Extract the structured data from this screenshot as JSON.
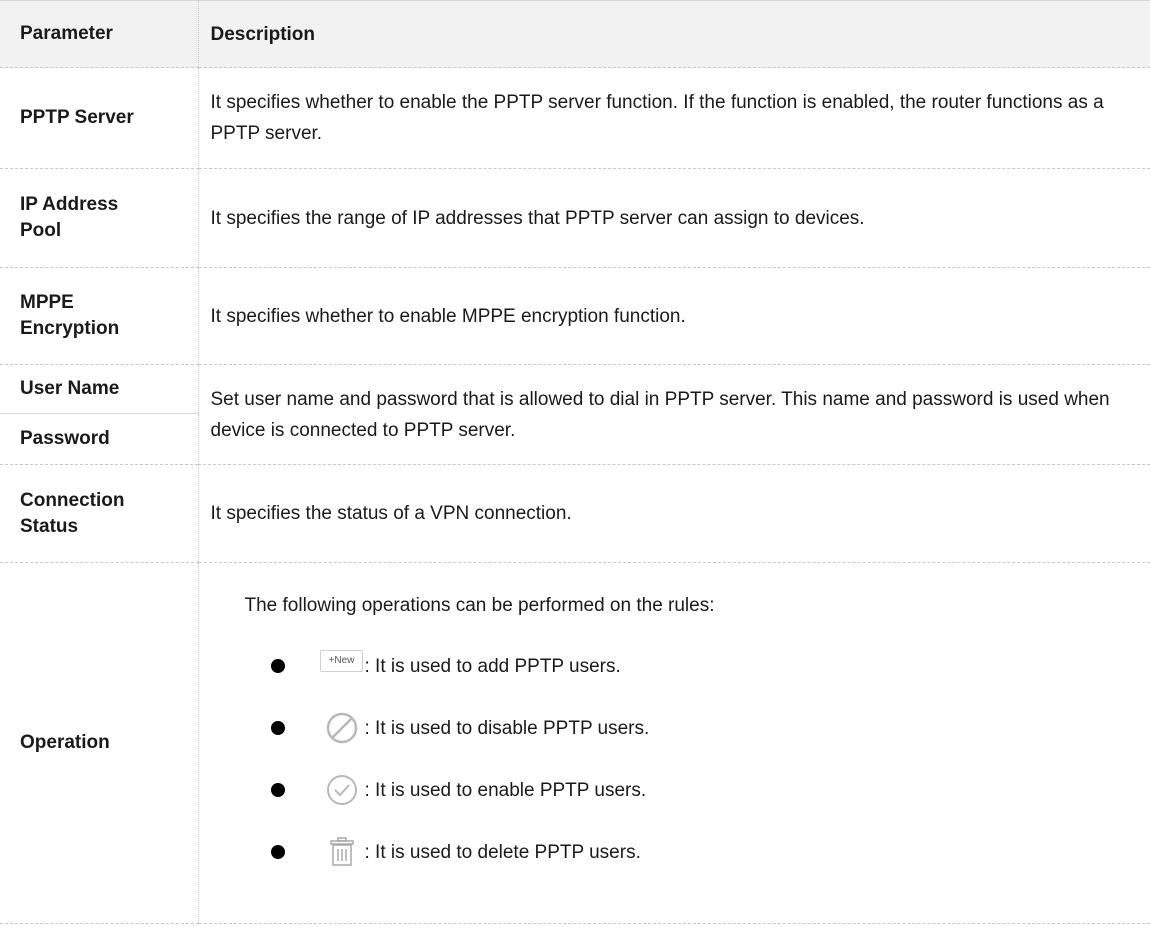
{
  "header": {
    "parameter": "Parameter",
    "description": "Description"
  },
  "rows": {
    "pptp_server": {
      "param": "PPTP Server",
      "desc": "It specifies whether to enable the PPTP server function. If the function is enabled, the router functions as a PPTP server."
    },
    "ip_pool": {
      "param_line1": "IP Address",
      "param_line2": "Pool",
      "desc": "It specifies the range of IP addresses that PPTP server can assign to devices."
    },
    "mppe": {
      "param_line1": "MPPE",
      "param_line2": "Encryption",
      "desc": "It specifies whether to enable MPPE encryption function."
    },
    "credentials": {
      "param_user": "User Name",
      "param_password": "Password",
      "desc": "Set user name and password that is allowed to dial in PPTP server. This name and password is used when device is connected to PPTP server."
    },
    "connection": {
      "param_line1": "Connection",
      "param_line2": "Status",
      "desc": "It specifies the status of a VPN connection."
    },
    "operation": {
      "param": "Operation",
      "intro": "The following operations can be performed on the rules:",
      "items": [
        {
          "icon": "new-button-icon",
          "button_label": "+New",
          "text": ": It is used to add PPTP users."
        },
        {
          "icon": "disable-icon",
          "text": ": It is used to disable PPTP users."
        },
        {
          "icon": "enable-check-icon",
          "text": ": It is used to enable PPTP users."
        },
        {
          "icon": "trash-icon",
          "text": ": It is used to delete PPTP users."
        }
      ]
    }
  },
  "colors": {
    "header_bg": "#f2f2f2",
    "border": "#c9c9c9",
    "icon_gray": "#b8b8b8"
  }
}
